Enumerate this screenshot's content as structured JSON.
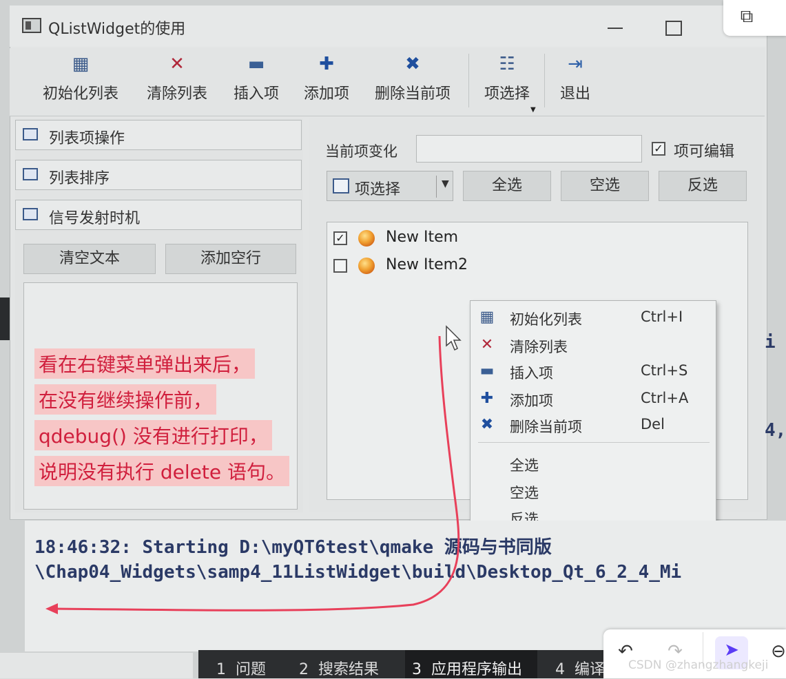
{
  "window": {
    "title": "QListWidget的使用"
  },
  "toolbar": {
    "items": [
      {
        "label": "初始化列表",
        "icon": "list-init-icon"
      },
      {
        "label": "清除列表",
        "icon": "clear-icon"
      },
      {
        "label": "插入项",
        "icon": "minus-icon"
      },
      {
        "label": "添加项",
        "icon": "plus-icon"
      },
      {
        "label": "删除当前项",
        "icon": "delete-icon"
      },
      {
        "label": "项选择",
        "icon": "select-icon"
      },
      {
        "label": "退出",
        "icon": "exit-icon"
      }
    ]
  },
  "toolbox": {
    "pages": [
      {
        "label": "列表项操作"
      },
      {
        "label": "列表排序"
      },
      {
        "label": "信号发射时机"
      }
    ],
    "clear_text_button": "清空文本",
    "add_empty_line_button": "添加空行"
  },
  "right": {
    "current_change_label": "当前项变化",
    "current_change_value": "",
    "editable_label": "项可编辑",
    "editable_checked": true,
    "select_combo_label": "项选择",
    "select_all_button": "全选",
    "select_none_button": "空选",
    "invert_button": "反选",
    "list": [
      {
        "text": "New Item",
        "checked": true
      },
      {
        "text": "New Item2",
        "checked": false
      }
    ]
  },
  "context_menu": {
    "items": [
      {
        "label": "初始化列表",
        "shortcut": "Ctrl+I",
        "icon": "list-init-icon"
      },
      {
        "label": "清除列表",
        "shortcut": "",
        "icon": "clear-icon"
      },
      {
        "label": "插入项",
        "shortcut": "Ctrl+S",
        "icon": "minus-icon"
      },
      {
        "label": "添加项",
        "shortcut": "Ctrl+A",
        "icon": "plus-icon"
      },
      {
        "label": "删除当前项",
        "shortcut": "Del",
        "icon": "delete-icon"
      }
    ],
    "select_items": [
      "全选",
      "空选",
      "反选"
    ]
  },
  "output": {
    "line1": "18:46:32: Starting D:\\myQT6test\\qmake 源码与书同版",
    "line2": "\\Chap04_Widgets\\samp4_11ListWidget\\build\\Desktop_Qt_6_2_4_Mi",
    "right_fragments": [
      "i",
      "4,"
    ]
  },
  "bottom_tabs": [
    {
      "num": "1",
      "label": "问题"
    },
    {
      "num": "2",
      "label": "搜索结果"
    },
    {
      "num": "3",
      "label": "应用程序输出"
    },
    {
      "num": "4",
      "label": "编译输出"
    }
  ],
  "annotation": {
    "lines": [
      "看在右键菜单弹出来后，",
      "在没有继续操作前，",
      "qdebug() 没有进行打印，",
      "说明没有执行 delete 语句。"
    ],
    "color": "#d01f3d"
  },
  "watermark": "CSDN @zhangzhangkeji"
}
